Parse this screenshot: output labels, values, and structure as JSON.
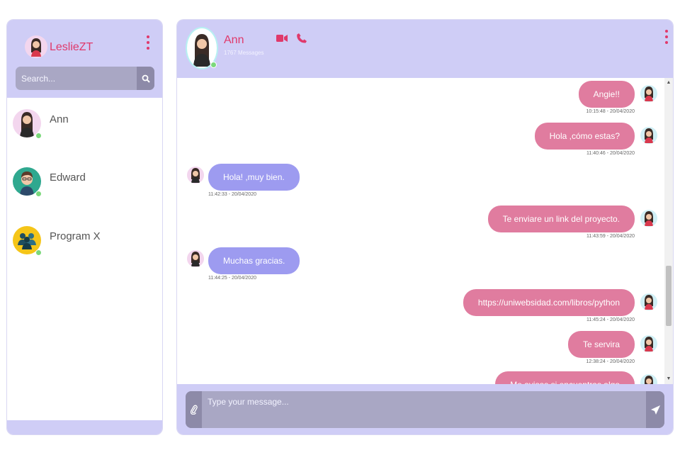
{
  "sidebar": {
    "user_name": "LeslieZT",
    "search_placeholder": "Search...",
    "contacts": [
      {
        "name": "Ann",
        "avatar_icon": "woman-avatar-icon",
        "status": "online"
      },
      {
        "name": "Edward",
        "avatar_icon": "man-avatar-icon",
        "status": "online"
      },
      {
        "name": "Program X",
        "avatar_icon": "group-avatar-icon",
        "status": "online"
      }
    ]
  },
  "chat": {
    "contact_name": "Ann",
    "message_count": "1767 Messages",
    "input_placeholder": "Type your message...",
    "messages": [
      {
        "from": "me",
        "text": "Angie!!",
        "time": "10:15:48 - 20/04/2020"
      },
      {
        "from": "me",
        "text": "Hola ,cómo estas?",
        "time": "11:40:46 - 20/04/2020"
      },
      {
        "from": "them",
        "text": "Hola! ,muy bien.",
        "time": "11:42:33 - 20/04/2020"
      },
      {
        "from": "me",
        "text": "Te enviare un link del proyecto.",
        "time": "11:43:59 - 20/04/2020"
      },
      {
        "from": "them",
        "text": "Muchas gracias.",
        "time": "11:44:25 - 20/04/2020"
      },
      {
        "from": "me",
        "text": "https://uniwebsidad.com/libros/python",
        "time": "11:45:24 - 20/04/2020"
      },
      {
        "from": "me",
        "text": "Te servira",
        "time": "12:38:24 - 20/04/2020"
      },
      {
        "from": "me",
        "text": "Me avisas si encuentras algo",
        "time": ""
      }
    ]
  },
  "colors": {
    "header_bg": "#cfcdf6",
    "accent": "#e0396b",
    "my_bubble": "#e07c9f",
    "their_bubble": "#9d9bf0",
    "online": "#7bd87b",
    "input_bg": "#a9a7c4"
  },
  "icons": {
    "menu": "kebab-menu-icon",
    "search": "search-icon",
    "video": "video-camera-icon",
    "call": "phone-icon",
    "attach": "paperclip-icon",
    "send": "send-icon"
  }
}
